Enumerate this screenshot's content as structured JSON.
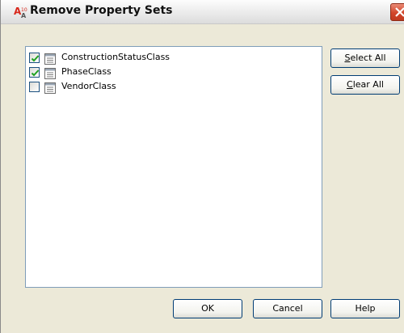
{
  "dialog": {
    "title": "Remove Property Sets",
    "close_icon": "close-icon",
    "app_icon": "autocad-architecture-icon"
  },
  "property_sets": [
    {
      "label": "ConstructionStatusClass",
      "checked": true,
      "icon": "property-set-icon"
    },
    {
      "label": "PhaseClass",
      "checked": true,
      "icon": "property-set-icon"
    },
    {
      "label": "VendorClass",
      "checked": false,
      "icon": "property-set-icon"
    }
  ],
  "buttons": {
    "select_all": {
      "mnemonic": "S",
      "rest": "elect All"
    },
    "clear_all": {
      "mnemonic": "C",
      "rest": "lear All"
    },
    "ok": "OK",
    "cancel": "Cancel",
    "help": "Help"
  },
  "colors": {
    "checkmark": "#21a121",
    "close_button": "#d2462b"
  }
}
